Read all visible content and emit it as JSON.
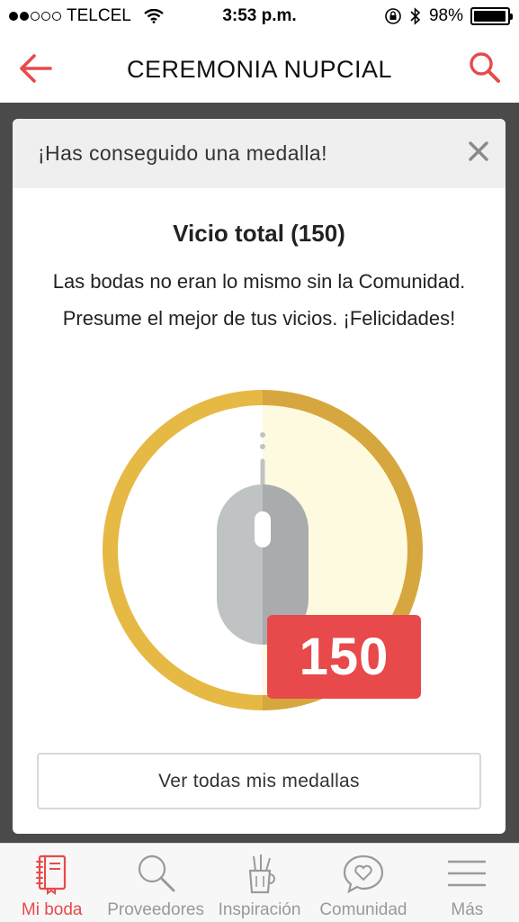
{
  "status_bar": {
    "carrier": "TELCEL",
    "time": "3:53 p.m.",
    "battery_percent": "98%",
    "battery_level": 0.98,
    "signal_bars_filled": 2,
    "signal_bars_total": 5,
    "icons": [
      "wifi-icon",
      "rotation-lock-icon",
      "bluetooth-icon",
      "battery-icon"
    ]
  },
  "header": {
    "title": "CEREMONIA NUPCIAL",
    "back_icon": "arrow-left-icon",
    "search_icon": "search-icon",
    "accent_color": "#e8494a"
  },
  "modal": {
    "title": "¡Has conseguido una medalla!",
    "close_icon": "close-icon",
    "medal_name": "Vicio total (150)",
    "description": "Las bodas no eran lo mismo sin la Comunidad. Presume el mejor de tus vicios. ¡Felicidades!",
    "medal_icon": "computer-mouse-icon",
    "medal_count": "150",
    "button_label": "Ver todas mis medallas",
    "colors": {
      "ring_gold": "#e6b944",
      "ring_gold_dark": "#d6a73e",
      "inner_light": "#fefae0",
      "badge_red": "#e8494a"
    }
  },
  "tab_bar": {
    "tabs": [
      {
        "label": "Mi boda",
        "icon": "notebook-icon",
        "active": true
      },
      {
        "label": "Proveedores",
        "icon": "search-icon",
        "active": false
      },
      {
        "label": "Inspiración",
        "icon": "pencil-cup-icon",
        "active": false
      },
      {
        "label": "Comunidad",
        "icon": "chat-heart-icon",
        "active": false
      },
      {
        "label": "Más",
        "icon": "menu-icon",
        "active": false
      }
    ]
  }
}
